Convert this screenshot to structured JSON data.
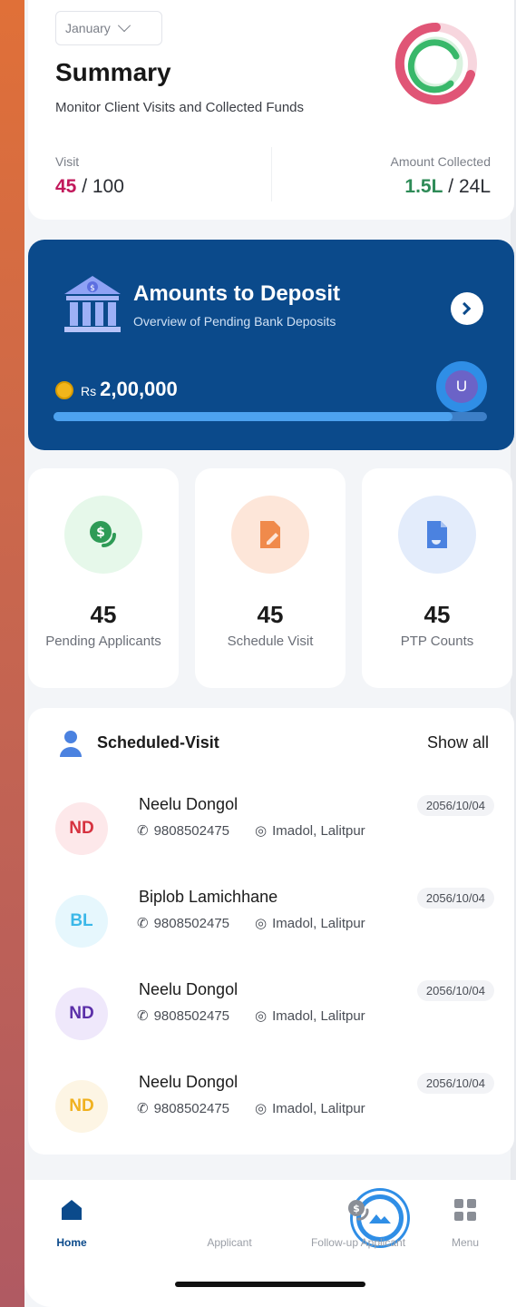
{
  "summary": {
    "month": "January",
    "title": "Summary",
    "subtitle": "Monitor Client Visits and Collected Funds",
    "visit_label": "Visit",
    "visit_done": "45",
    "visit_total": " / 100",
    "amount_label": "Amount Collected",
    "amount_done": "1.5L",
    "amount_total": " / 24L"
  },
  "deposit": {
    "title": "Amounts to Deposit",
    "subtitle": "Overview of Pending Bank Deposits",
    "currency": "Rs",
    "amount": "2,00,000",
    "avatar": "U",
    "progress": 0.92
  },
  "tiles": [
    {
      "count": "45",
      "label": "Pending Applicants",
      "icon": "dollar-coins-icon",
      "bg": "#e6f8ea",
      "color": "#2e9b56"
    },
    {
      "count": "45",
      "label": "Schedule Visit",
      "icon": "document-edit-icon",
      "bg": "#fde6d9",
      "color": "#f08a4b"
    },
    {
      "count": "45",
      "label": "PTP Counts",
      "icon": "document-icon",
      "bg": "#e3ecfb",
      "color": "#4b82e0"
    }
  ],
  "scheduled": {
    "title": "Scheduled-Visit",
    "show_all": "Show all",
    "items": [
      {
        "initials": "ND",
        "name": "Neelu Dongol",
        "phone": "9808502475",
        "location": "Imadol, Lalitpur",
        "date": "2056/10/04",
        "bg": "#fde8ea",
        "color": "#d6323f"
      },
      {
        "initials": "BL",
        "name": "Biplob Lamichhane",
        "phone": "9808502475",
        "location": "Imadol, Lalitpur",
        "date": "2056/10/04",
        "bg": "#e6f7fd",
        "color": "#3bb8e8"
      },
      {
        "initials": "ND",
        "name": "Neelu Dongol",
        "phone": "9808502475",
        "location": "Imadol, Lalitpur",
        "date": "2056/10/04",
        "bg": "#efe8fb",
        "color": "#5b2fa8"
      },
      {
        "initials": "ND",
        "name": "Neelu Dongol",
        "phone": "9808502475",
        "location": "Imadol, Lalitpur",
        "date": "2056/10/04",
        "bg": "#fdf5e4",
        "color": "#f0b11f"
      }
    ]
  },
  "nav": {
    "home": "Home",
    "applicant": "Applicant",
    "followup": "Follow-up Applicant",
    "menu": "Menu"
  },
  "colors": {
    "primary": "#0b4a8b",
    "visit_highlight": "#c2185b",
    "amount_highlight": "#2e8b57"
  }
}
